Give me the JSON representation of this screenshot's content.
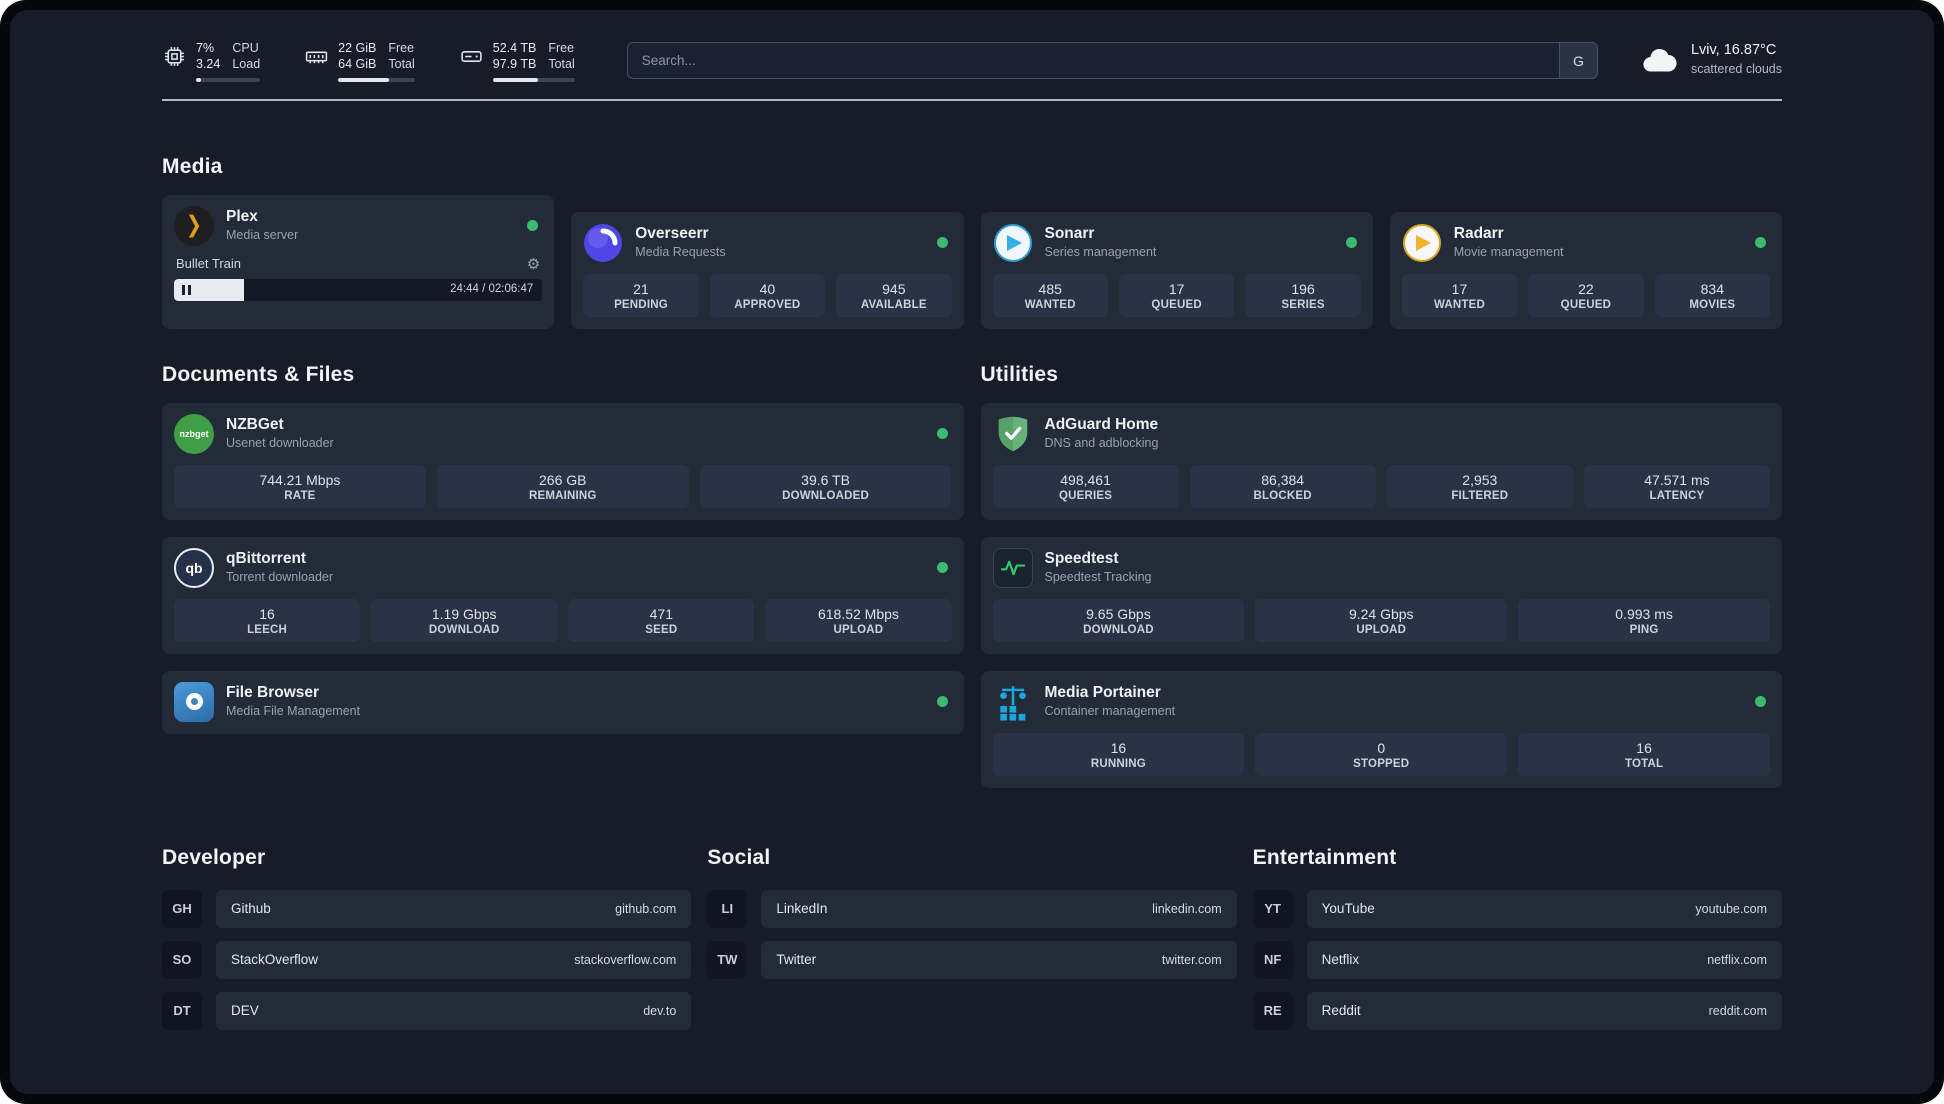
{
  "theme": {
    "page_bg": "#171c28",
    "card_bg": "#232a38",
    "tile_bg": "#2b3245",
    "status_green": "#3cba6f",
    "plex_amber": "#e5a00d",
    "portainer_blue": "#1aa7dd"
  },
  "icons": {
    "gear": "⚙"
  },
  "topbar": {
    "cpu": {
      "value": "7%",
      "value2": "3.24",
      "label1": "CPU",
      "label2": "Load",
      "percent": 8
    },
    "ram": {
      "value": "22 GiB",
      "value2": "64 GiB",
      "label1": "Free",
      "label2": "Total",
      "percent": 66
    },
    "disk": {
      "value": "52.4 TB",
      "value2": "97.9 TB",
      "label1": "Free",
      "label2": "Total",
      "percent": 55
    },
    "search": {
      "placeholder": "Search...",
      "button_label": "G"
    },
    "weather": {
      "location": "Lviv, 16.87°C",
      "condition": "scattered clouds"
    }
  },
  "sections": {
    "media": {
      "title": "Media",
      "plex": {
        "name": "Plex",
        "subtitle": "Media server",
        "player": {
          "title": "Bullet Train",
          "time": "24:44 / 02:06:47",
          "progress": 19
        }
      },
      "overseerr": {
        "name": "Overseerr",
        "subtitle": "Media Requests",
        "stats": [
          {
            "value": "21",
            "label": "PENDING"
          },
          {
            "value": "40",
            "label": "APPROVED"
          },
          {
            "value": "945",
            "label": "AVAILABLE"
          }
        ]
      },
      "sonarr": {
        "name": "Sonarr",
        "subtitle": "Series management",
        "stats": [
          {
            "value": "485",
            "label": "WANTED"
          },
          {
            "value": "17",
            "label": "QUEUED"
          },
          {
            "value": "196",
            "label": "SERIES"
          }
        ]
      },
      "radarr": {
        "name": "Radarr",
        "subtitle": "Movie management",
        "stats": [
          {
            "value": "17",
            "label": "WANTED"
          },
          {
            "value": "22",
            "label": "QUEUED"
          },
          {
            "value": "834",
            "label": "MOVIES"
          }
        ]
      }
    },
    "documents": {
      "title": "Documents & Files",
      "nzbget": {
        "name": "NZBGet",
        "subtitle": "Usenet downloader",
        "icon_text": "nzbget",
        "stats": [
          {
            "value": "744.21 Mbps",
            "label": "RATE"
          },
          {
            "value": "266 GB",
            "label": "REMAINING"
          },
          {
            "value": "39.6 TB",
            "label": "DOWNLOADED"
          }
        ]
      },
      "qbittorrent": {
        "name": "qBittorrent",
        "subtitle": "Torrent downloader",
        "icon_text": "qb",
        "stats": [
          {
            "value": "16",
            "label": "LEECH"
          },
          {
            "value": "1.19 Gbps",
            "label": "DOWNLOAD"
          },
          {
            "value": "471",
            "label": "SEED"
          },
          {
            "value": "618.52 Mbps",
            "label": "UPLOAD"
          }
        ]
      },
      "filebrowser": {
        "name": "File Browser",
        "subtitle": "Media File Management"
      }
    },
    "utilities": {
      "title": "Utilities",
      "adguard": {
        "name": "AdGuard Home",
        "subtitle": "DNS and adblocking",
        "stats": [
          {
            "value": "498,461",
            "label": "QUERIES"
          },
          {
            "value": "86,384",
            "label": "BLOCKED"
          },
          {
            "value": "2,953",
            "label": "FILTERED"
          },
          {
            "value": "47.571 ms",
            "label": "LATENCY"
          }
        ]
      },
      "speedtest": {
        "name": "Speedtest",
        "subtitle": "Speedtest Tracking",
        "stats": [
          {
            "value": "9.65 Gbps",
            "label": "DOWNLOAD"
          },
          {
            "value": "9.24 Gbps",
            "label": "UPLOAD"
          },
          {
            "value": "0.993 ms",
            "label": "PING"
          }
        ]
      },
      "portainer": {
        "name": "Media Portainer",
        "subtitle": "Container management",
        "stats": [
          {
            "value": "16",
            "label": "RUNNING"
          },
          {
            "value": "0",
            "label": "STOPPED"
          },
          {
            "value": "16",
            "label": "TOTAL"
          }
        ]
      }
    },
    "developer": {
      "title": "Developer",
      "items": [
        {
          "abbr": "GH",
          "name": "Github",
          "url": "github.com"
        },
        {
          "abbr": "SO",
          "name": "StackOverflow",
          "url": "stackoverflow.com"
        },
        {
          "abbr": "DT",
          "name": "DEV",
          "url": "dev.to"
        }
      ]
    },
    "social": {
      "title": "Social",
      "items": [
        {
          "abbr": "LI",
          "name": "LinkedIn",
          "url": "linkedin.com"
        },
        {
          "abbr": "TW",
          "name": "Twitter",
          "url": "twitter.com"
        }
      ]
    },
    "entertainment": {
      "title": "Entertainment",
      "items": [
        {
          "abbr": "YT",
          "name": "YouTube",
          "url": "youtube.com"
        },
        {
          "abbr": "NF",
          "name": "Netflix",
          "url": "netflix.com"
        },
        {
          "abbr": "RE",
          "name": "Reddit",
          "url": "reddit.com"
        }
      ]
    }
  }
}
